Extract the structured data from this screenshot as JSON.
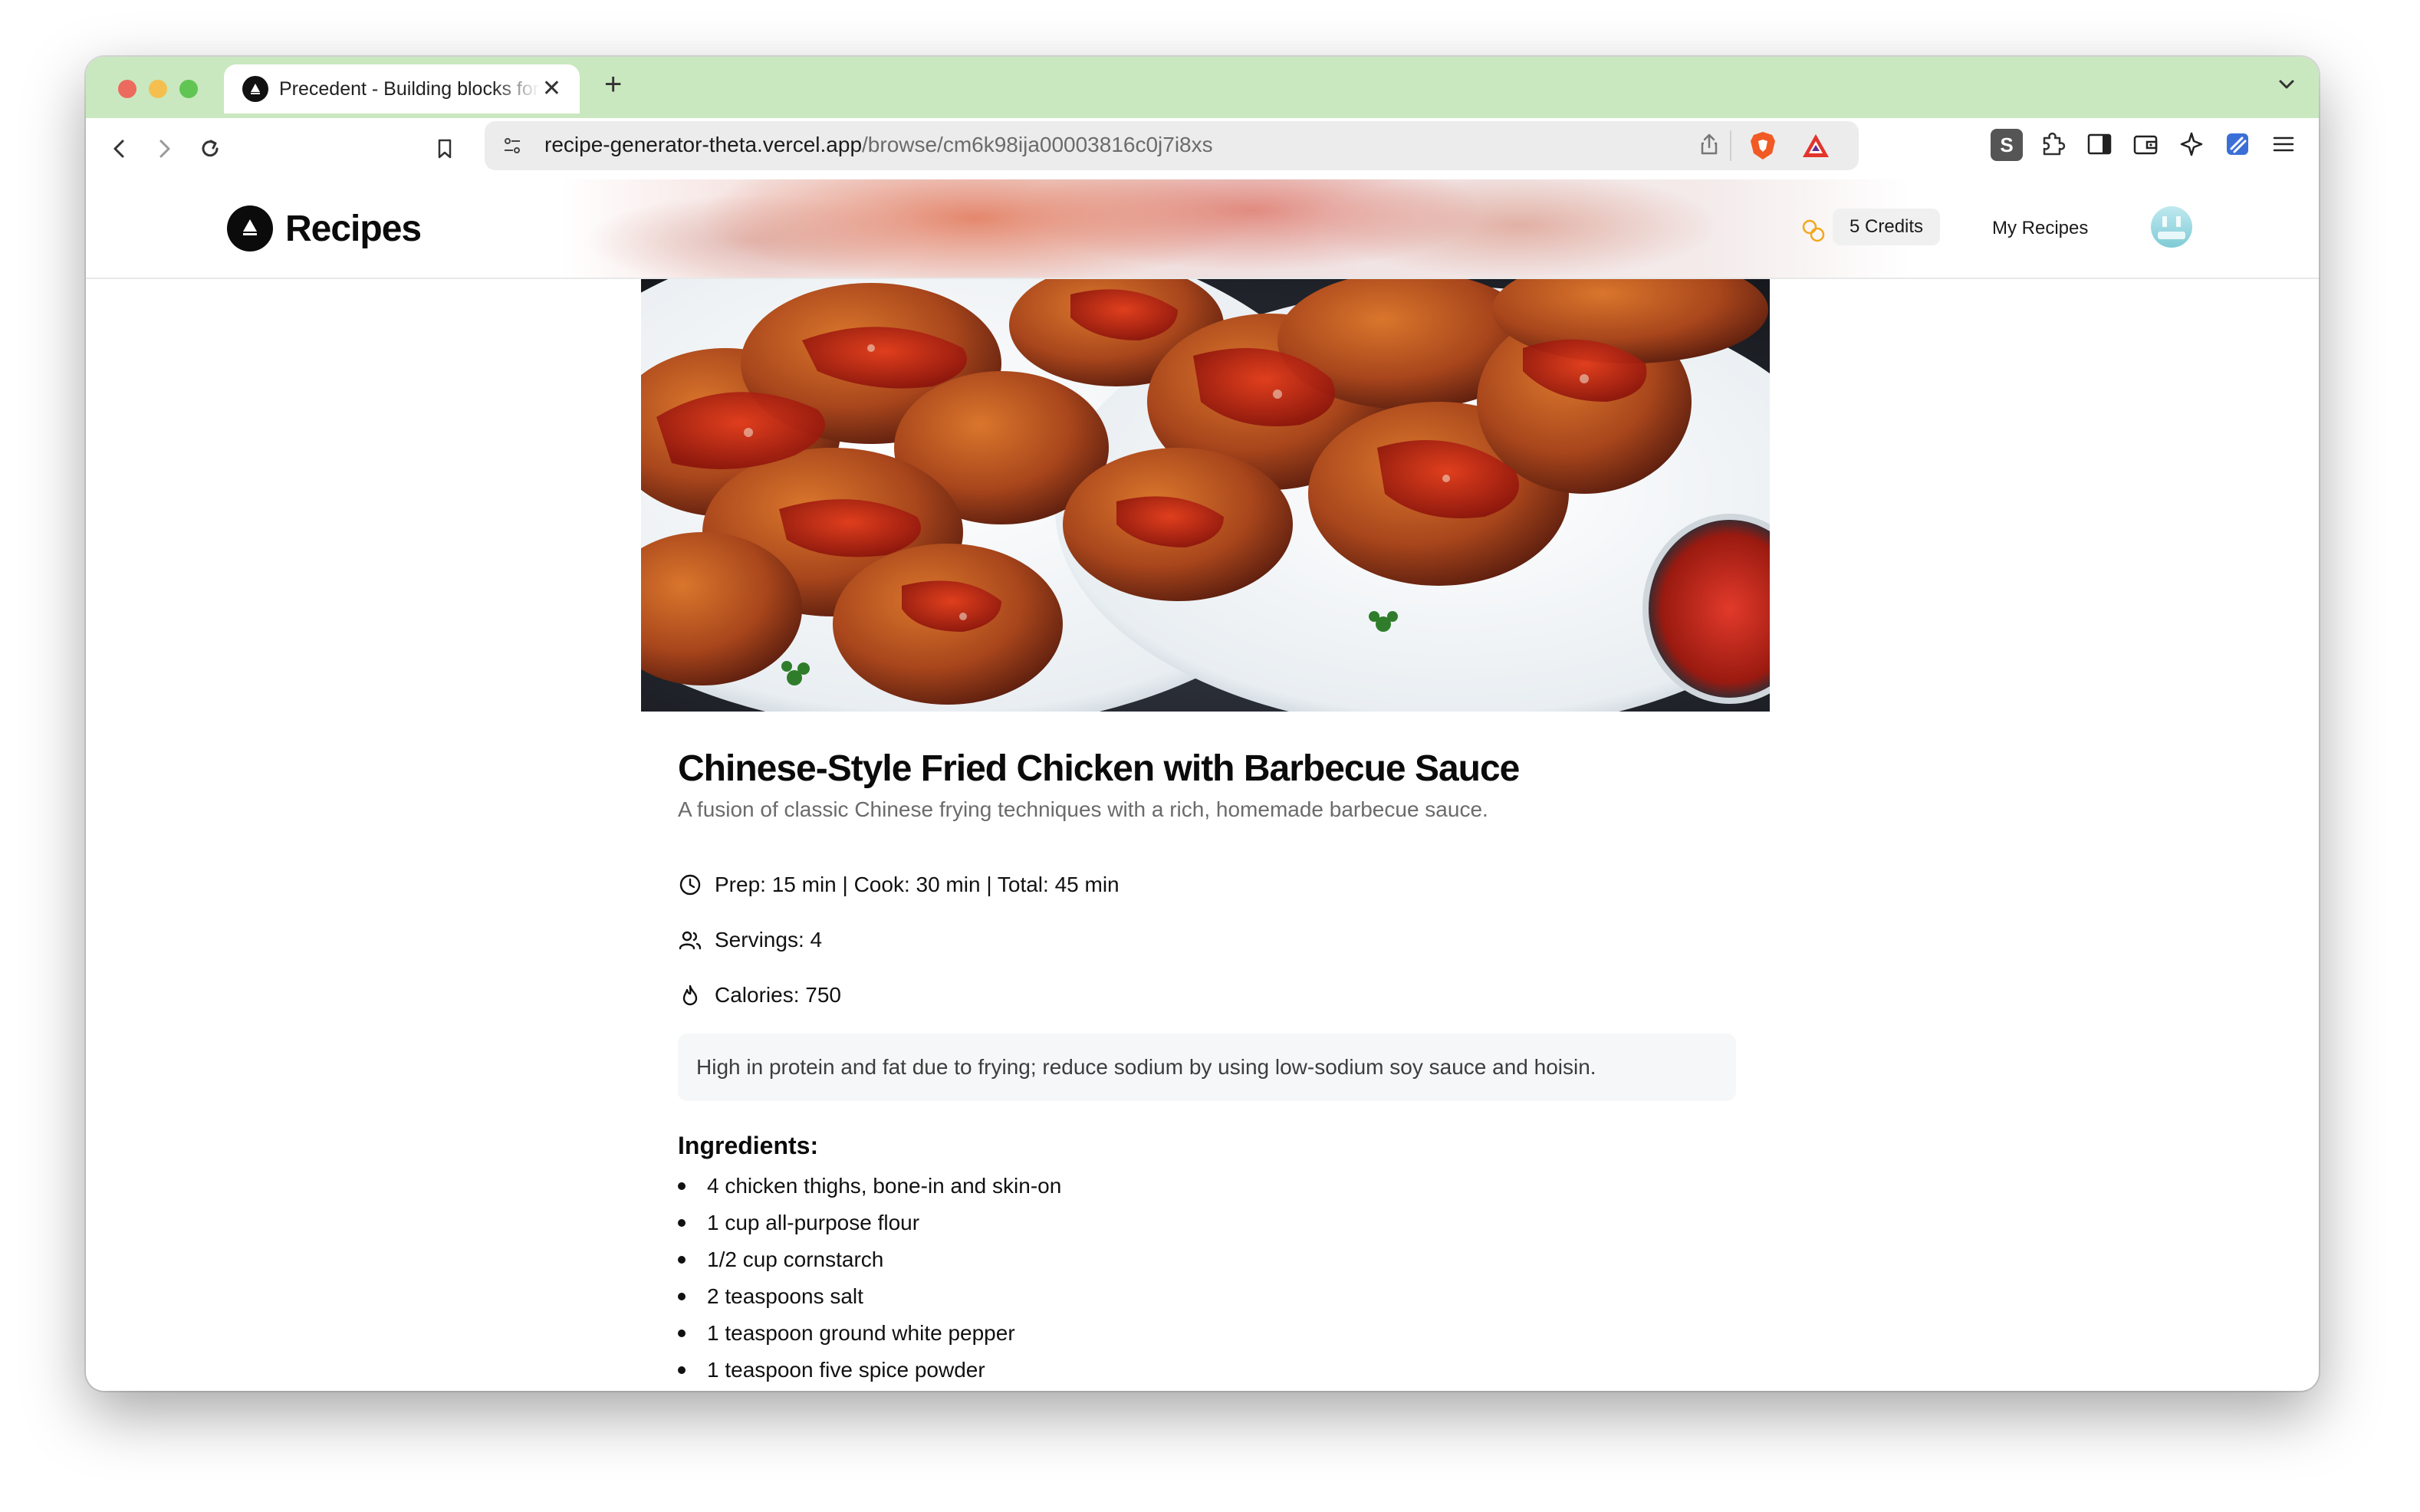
{
  "browser": {
    "tab_title": "Precedent - Building blocks for your Next.js project",
    "url_host": "recipe-generator-theta.vercel.app",
    "url_path": "/browse/cm6k98ija00003816c0j7i8xs"
  },
  "header": {
    "brand": "Recipes",
    "credits": "5 Credits",
    "my_recipes": "My Recipes"
  },
  "recipe": {
    "title": "Chinese-Style Fried Chicken with Barbecue Sauce",
    "description": "A fusion of classic Chinese frying techniques with a rich, homemade barbecue sauce.",
    "time": "Prep: 15 min | Cook: 30 min | Total: 45 min",
    "servings": "Servings: 4",
    "calories": "Calories: 750",
    "nutrition_note": "High in protein and fat due to frying; reduce sodium by using low-sodium soy sauce and hoisin.",
    "ingredients_heading": "Ingredients:",
    "ingredients": [
      "4 chicken thighs, bone-in and skin-on",
      "1 cup all-purpose flour",
      "1/2 cup cornstarch",
      "2 teaspoons salt",
      "1 teaspoon ground white pepper",
      "1 teaspoon five spice powder"
    ]
  },
  "colors": {
    "tabstrip": "#c9e8bf",
    "brand_icon": "#0b0b0b",
    "credits_icon": "#f0a81c",
    "note_bg": "#f6f7f8"
  },
  "icons": {
    "time": "clock-icon",
    "servings": "users-icon",
    "calories": "flame-icon"
  }
}
